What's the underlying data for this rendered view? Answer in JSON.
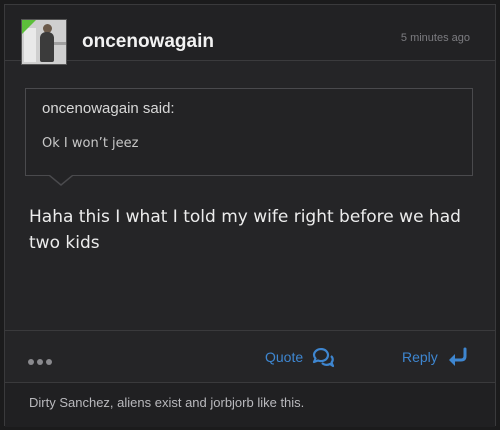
{
  "post": {
    "author": "oncenowagain",
    "time": "5 minutes ago",
    "quote": {
      "attribution": "oncenowagain said:",
      "text": "Ok I won’t jeez"
    },
    "message": "Haha this I what I told my wife right before we had two kids",
    "actions": {
      "quote_label": "Quote",
      "reply_label": "Reply"
    },
    "likes_text": "Dirty Sanchez, aliens exist and jorbjorb like this."
  },
  "colors": {
    "background": "#252527",
    "accent_link": "#3e86d0",
    "online_indicator": "#5cbf3a"
  },
  "icons": [
    "more-dots-icon",
    "quote-bubble-icon",
    "reply-arrow-icon"
  ]
}
